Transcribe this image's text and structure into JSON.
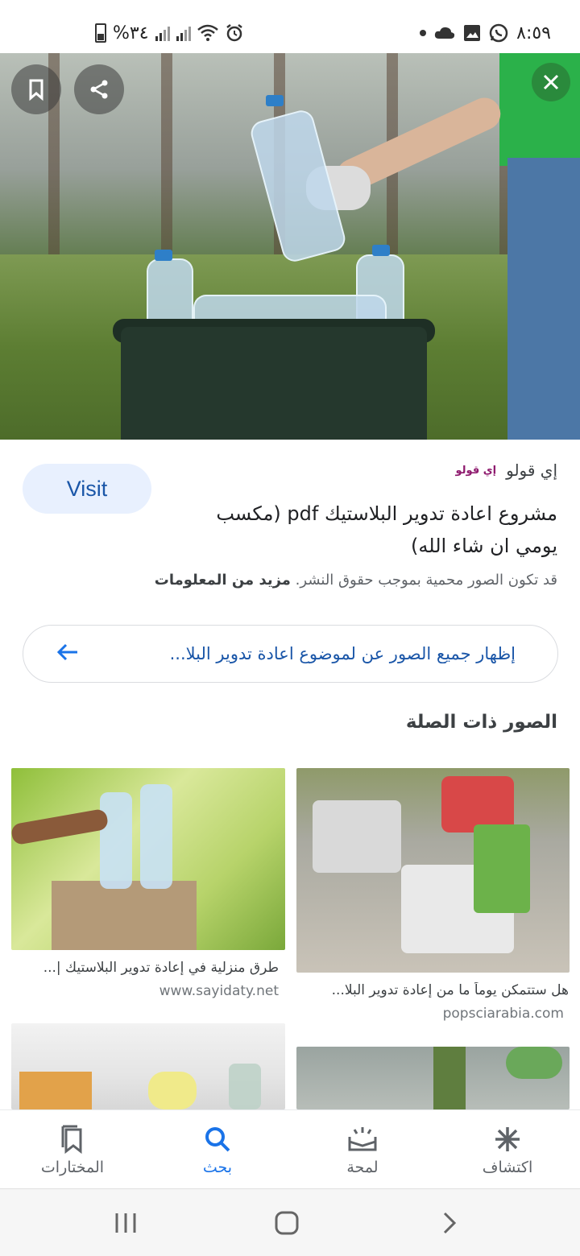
{
  "status_bar": {
    "time": "٨:٥٩",
    "battery": "%٣٤"
  },
  "hero": {
    "bookmark_icon": "bookmark-icon",
    "share_icon": "share-icon",
    "close_icon": "close-icon"
  },
  "result": {
    "visit_label": "Visit",
    "source_logo": "إي قولو",
    "source_name": "إي قولو",
    "title": "مشروع اعادة تدوير البلاستيك pdf (مكسب يومي ان شاء الله)",
    "copyright_text": "قد تكون الصور محمية بموجب حقوق النشر.",
    "more_info": "مزيد من المعلومات"
  },
  "show_all": {
    "label": "إظهار جميع الصور عن لموضوع اعادة تدوير البلا..."
  },
  "related": {
    "title": "الصور ذات الصلة",
    "items": [
      {
        "caption": "هل ستتمكن يوماً ما من إعادة تدوير البلا...",
        "source": "popsciarabia.com"
      },
      {
        "caption": "طرق منزلية في إعادة تدوير البلاستيك |...",
        "source": "www.sayidaty.net"
      }
    ]
  },
  "bottom_nav": {
    "items": [
      {
        "label": "اكتشاف",
        "icon": "asterisk-icon"
      },
      {
        "label": "لمحة",
        "icon": "snapshot-icon"
      },
      {
        "label": "بحث",
        "icon": "search-icon"
      },
      {
        "label": "المختارات",
        "icon": "collections-icon"
      }
    ]
  },
  "colors": {
    "accent": "#1a73e8",
    "visit_bg": "#e8f0fe"
  }
}
